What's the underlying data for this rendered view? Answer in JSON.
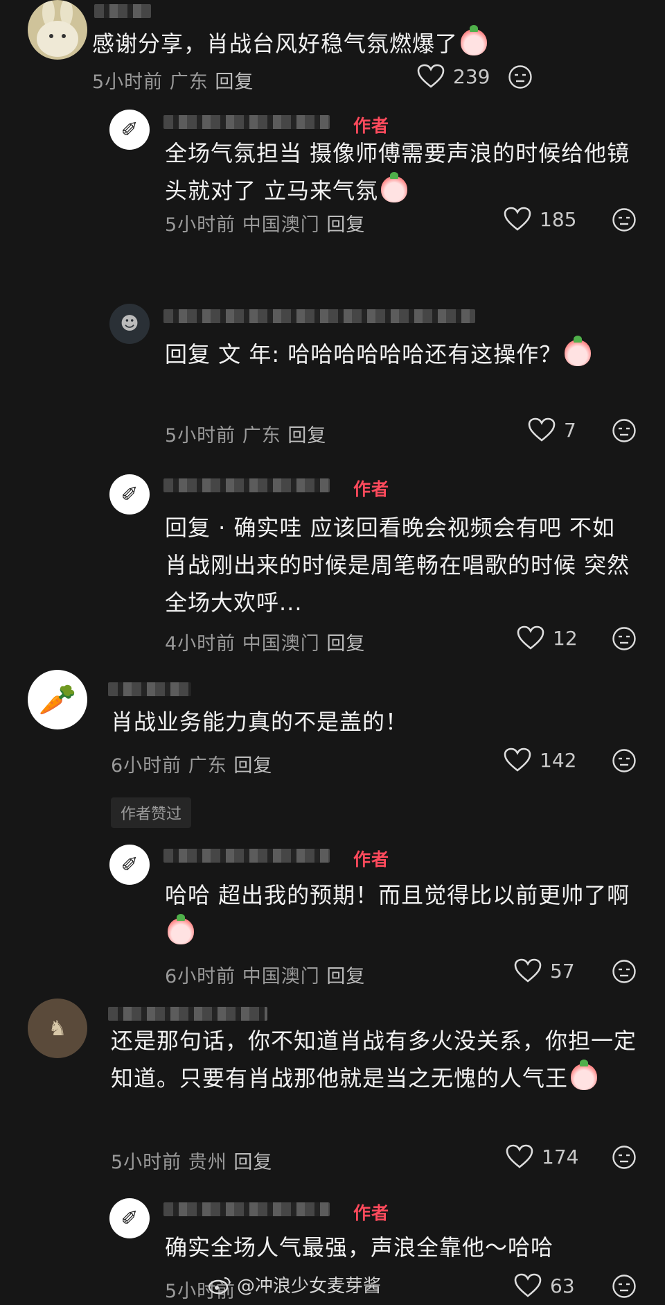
{
  "comments": [
    {
      "text": "感谢分享，肖战台风好稳气氛燃爆了",
      "time": "5小时前",
      "location": "广东",
      "reply": "回复",
      "likes": "239"
    },
    {
      "text": "全场气氛担当 摄像师傅需要声浪的时候给他镜头就对了 立马来气氛",
      "time": "5小时前",
      "location": "中国澳门",
      "reply": "回复",
      "likes": "185",
      "badge": "作者"
    },
    {
      "text": "回复 文 年: 哈哈哈哈哈哈还有这操作？",
      "time": "5小时前",
      "location": "广东",
      "reply": "回复",
      "likes": "7"
    },
    {
      "text": "回复 · 确实哇 应该回看晚会视频会有吧 不如肖战刚出来的时候是周笔畅在唱歌的时候 突然全场大欢呼...",
      "time": "4小时前",
      "location": "中国澳门",
      "reply": "回复",
      "likes": "12",
      "badge": "作者"
    },
    {
      "text": "肖战业务能力真的不是盖的！",
      "time": "6小时前",
      "location": "广东",
      "reply": "回复",
      "likes": "142"
    },
    {
      "text": "哈哈 超出我的预期！而且觉得比以前更帅了啊",
      "time": "6小时前",
      "location": "中国澳门",
      "reply": "回复",
      "likes": "57",
      "badge": "作者"
    },
    {
      "text": "还是那句话，你不知道肖战有多火没关系，你担一定知道。只要有肖战那他就是当之无愧的人气王",
      "time": "5小时前",
      "location": "贵州",
      "reply": "回复",
      "likes": "174"
    },
    {
      "text": "确实全场人气最强，声浪全靠他～哈哈",
      "time": "5小时前",
      "location": "",
      "reply": "",
      "likes": "63",
      "badge": "作者"
    }
  ],
  "liked_by_author": "作者赞过",
  "watermark": "@冲浪少女麦芽酱",
  "colors": {
    "background": "#161616",
    "author_badge": "#ff4a5c",
    "meta": "#9a9a9a"
  },
  "icons": {
    "like": "heart-outline-icon",
    "reaction": "neutral-face-icon",
    "emoji": "peach-emoji-icon",
    "watermark": "weibo-logo-icon"
  }
}
